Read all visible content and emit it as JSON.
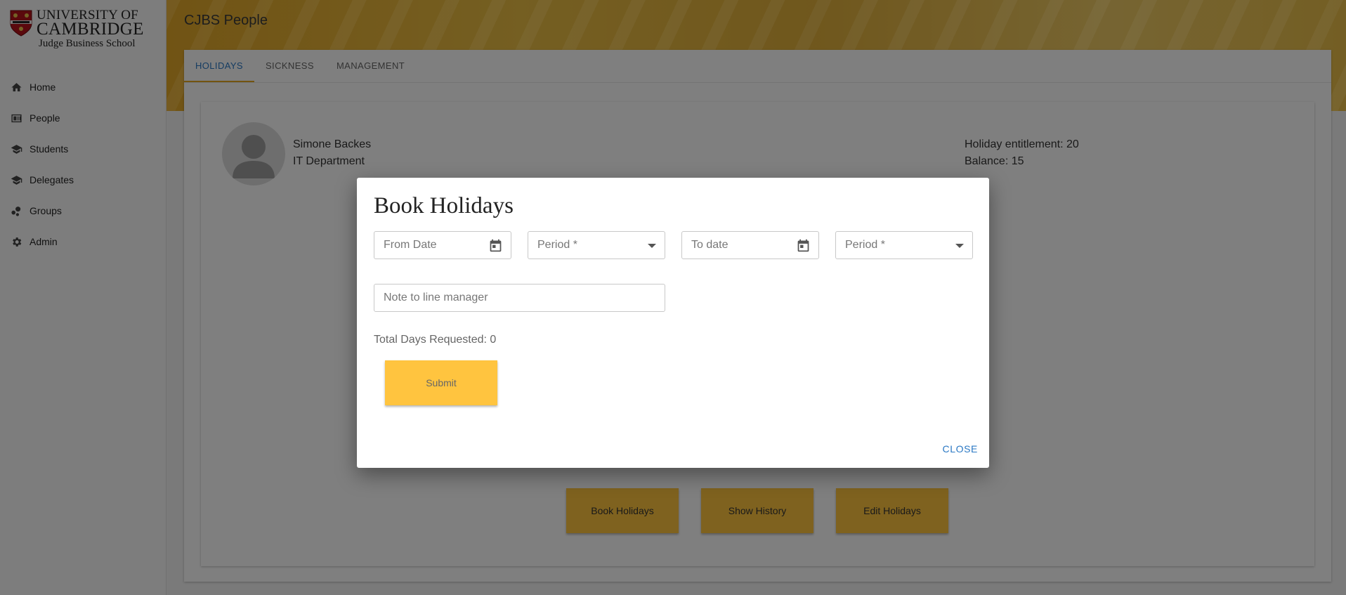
{
  "logo": {
    "line1": "UNIVERSITY OF",
    "line2": "CAMBRIDGE",
    "line3": "Judge Business School"
  },
  "sidebar": {
    "items": [
      {
        "label": "Home",
        "icon": "home-icon"
      },
      {
        "label": "People",
        "icon": "id-card-icon"
      },
      {
        "label": "Students",
        "icon": "graduation-cap-icon"
      },
      {
        "label": "Delegates",
        "icon": "graduation-cap-icon"
      },
      {
        "label": "Groups",
        "icon": "group-icon"
      },
      {
        "label": "Admin",
        "icon": "gear-icon"
      }
    ]
  },
  "header": {
    "title": "CJBS People"
  },
  "tabs": [
    {
      "label": "HOLIDAYS",
      "active": true
    },
    {
      "label": "SICKNESS",
      "active": false
    },
    {
      "label": "MANAGEMENT",
      "active": false
    }
  ],
  "employee": {
    "name": "Simone Backes",
    "department": "IT Department",
    "entitlement": "Holiday entitlement: 20",
    "balance": "Balance: 15"
  },
  "actions": {
    "book": "Book Holidays",
    "history": "Show History",
    "edit": "Edit Holidays"
  },
  "dialog": {
    "title": "Book Holidays",
    "from_date_placeholder": "From Date",
    "from_period": "Period *",
    "to_date_placeholder": "To date",
    "to_period": "Period *",
    "note_placeholder": "Note to line manager",
    "total": "Total Days Requested: 0",
    "submit": "Submit",
    "close": "CLOSE"
  },
  "colors": {
    "accent": "#ffc43f",
    "link": "#2a78c4",
    "tab_underline": "#e6a820"
  }
}
